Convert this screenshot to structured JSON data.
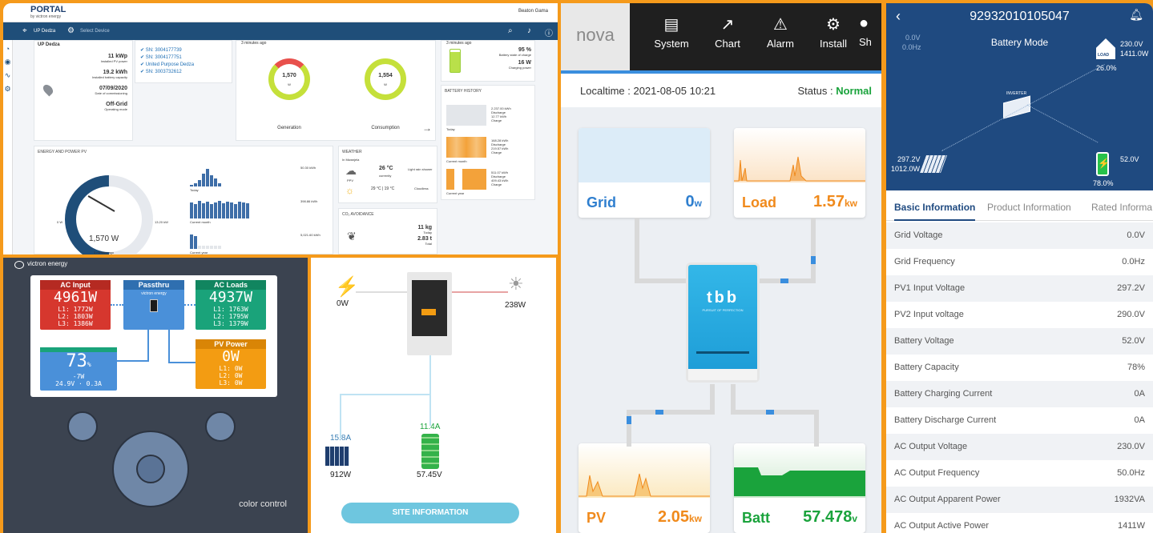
{
  "vrm": {
    "logo": "PORTAL",
    "logo_sub": "by victron energy",
    "user": "Beaton Gama",
    "nav": {
      "site": "UP Dedza",
      "select": "Select Device"
    },
    "site_title": "UP Dedza",
    "time_ago": "3 minutes ago",
    "time_ago2": "3 minutes ago",
    "info": [
      {
        "val": "11 kWp",
        "lbl": "Installed PV power"
      },
      {
        "val": "19.2 kWh",
        "lbl": "Installed battery capacity"
      },
      {
        "val": "07/09/2020",
        "lbl": "Date of commissioning"
      },
      {
        "val": "Off-Grid",
        "lbl": "Operating mode"
      }
    ],
    "serials": [
      "SN: 3004177739",
      "SN: 3004177751",
      "United Purpose Dedza",
      "SN: 3003732612"
    ],
    "generation": {
      "value": "1,570",
      "unit": "W",
      "label": "Generation"
    },
    "consumption": {
      "value": "1,554",
      "unit": "W",
      "label": "Consumption"
    },
    "battery": {
      "soc": "95 %",
      "soc_lbl": "Battery state of charge",
      "power": "16 W",
      "power_lbl": "Charging power"
    },
    "battery_history": "BATTERY HISTORY",
    "bh_rows": [
      {
        "a": "2.237.00 kWh",
        "b": "Discharge",
        "c": "12.77 kWh",
        "d": "Charge",
        "p": "Today"
      },
      {
        "a": "168.28 kWh",
        "b": "Discharge",
        "c": "219.57 kWh",
        "d": "Charge",
        "p": "Current month"
      },
      {
        "a": "511.07 kWh",
        "b": "Discharge",
        "c": "409.43 kWh",
        "d": "Charge",
        "p": "Current year"
      }
    ],
    "energy_title": "ENERGY AND POWER PV",
    "gauge_min": "0 W",
    "gauge_max": "13.20 kW",
    "gauge_value": "1,570 W",
    "gauge_ago": "3 minutes ago",
    "periods": [
      {
        "lbl": "Today",
        "val": "50.30 kWh"
      },
      {
        "lbl": "Current month",
        "val": "398.86 kWh"
      },
      {
        "lbl": "Current year",
        "val": "5,021.60 kWh"
      }
    ],
    "weather": {
      "title": "WEATHER",
      "place": "In Mwanjela",
      "temp": "26 °C",
      "temp_lbl": "currently",
      "desc": "Light rain shower",
      "low": "29 °C | 19 °C",
      "desc2": "Cloudless",
      "ppv": "PPV"
    },
    "co2": {
      "title": "CO₂ AVOIDANCE",
      "v1": "11 kg",
      "l1": "Today",
      "v2": "2.83 t",
      "l2": "Total"
    }
  },
  "victron": {
    "brand": "victron energy",
    "cc": "color control",
    "ac_input": {
      "h": "AC Input",
      "v": "4961W",
      "l": [
        "L1: 1772W",
        "L2: 1803W",
        "L3: 1386W"
      ]
    },
    "passthru": {
      "h": "Passthru",
      "sub": "victron energy"
    },
    "ac_loads": {
      "h": "AC Loads",
      "v": "4937W",
      "l": [
        "L1: 1763W",
        "L2: 1795W",
        "L3: 1379W"
      ]
    },
    "battery": {
      "v": "73",
      "unit": "%",
      "l": [
        "-7W",
        "24.9V · 0.3A"
      ]
    },
    "pv": {
      "h": "PV Power",
      "v": "0W",
      "l": [
        "L1: 0W",
        "L2: 0W",
        "L3: 0W"
      ]
    }
  },
  "flow": {
    "grid": "0W",
    "load": "238W",
    "pv_a": "15.8A",
    "pv_w": "912W",
    "bat_a": "11.4A",
    "bat_v": "57.45V",
    "button": "SITE INFORMATION"
  },
  "nova": {
    "logo": "nova",
    "tabs": [
      "System",
      "Chart",
      "Alarm",
      "Install",
      "Sh"
    ],
    "localtime": "Localtime : 2021-08-05 10:21",
    "status_lbl": "Status :",
    "status": "Normal",
    "grid": {
      "name": "Grid",
      "value": "0",
      "unit": "w"
    },
    "load": {
      "name": "Load",
      "value": "1.57",
      "unit": "kw"
    },
    "pv": {
      "name": "PV",
      "value": "2.05",
      "unit": "kw"
    },
    "batt": {
      "name": "Batt",
      "value": "57.478",
      "unit": "v"
    },
    "inverter_brand": "tbb",
    "inverter_sub": "PURSUIT OF PERFECTION",
    "colors": {
      "grid": "#4a90d9",
      "load": "#f08a1c",
      "pv": "#f08a1c",
      "batt": "#1aa33c"
    }
  },
  "app": {
    "title": "92932010105047",
    "mode": "Battery Mode",
    "grid_v": "0.0V",
    "grid_hz": "0.0Hz",
    "load_v": "230.0V",
    "load_w": "1411.0W",
    "load_pct": "26.0%",
    "pv_v": "297.2V",
    "pv_w": "1012.0W",
    "bat_v": "52.0V",
    "bat_pct": "78.0%",
    "inverter": "INVERTER",
    "load_lbl": "LOAD",
    "tabs": [
      "Basic Information",
      "Product Information",
      "Rated Informa"
    ],
    "rows": [
      {
        "k": "Grid Voltage",
        "v": "0.0V"
      },
      {
        "k": "Grid Frequency",
        "v": "0.0Hz"
      },
      {
        "k": "PV1 Input Voltage",
        "v": "297.2V"
      },
      {
        "k": "PV2 Input voltage",
        "v": "290.0V"
      },
      {
        "k": "Battery Voltage",
        "v": "52.0V"
      },
      {
        "k": "Battery Capacity",
        "v": "78%"
      },
      {
        "k": "Battery Charging Current",
        "v": "0A"
      },
      {
        "k": "Battery Discharge Current",
        "v": "0A"
      },
      {
        "k": "AC Output Voltage",
        "v": "230.0V"
      },
      {
        "k": "AC Output Frequency",
        "v": "50.0Hz"
      },
      {
        "k": "AC Output Apparent Power",
        "v": "1932VA"
      },
      {
        "k": "AC Output Active Power",
        "v": "1411W"
      }
    ]
  }
}
